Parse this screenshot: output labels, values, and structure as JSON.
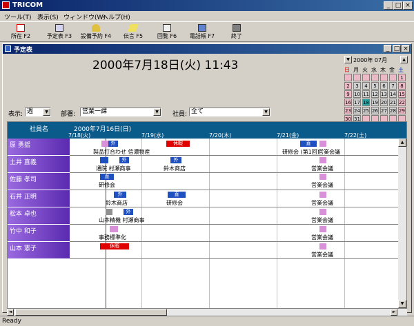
{
  "app": {
    "title": "TRICOM",
    "status": "Ready"
  },
  "menu": [
    "ツール(T)",
    "表示(S)",
    "ウィンドウ(W)",
    "ヘルプ(H)"
  ],
  "toolbar": [
    "所在 F2",
    "予定表 F3",
    "設備予約 F4",
    "伝言 F5",
    "回覧 F6",
    "電話帳 F7",
    "終了"
  ],
  "window": {
    "title": "予定表"
  },
  "datetime": "2000年7月18日(火)  11:43",
  "calendar": {
    "title": "2000年 07月",
    "weekdays": [
      "日",
      "月",
      "火",
      "水",
      "木",
      "金",
      "土"
    ],
    "rows": [
      [
        "",
        "",
        "",
        "",
        "",
        "",
        "1"
      ],
      [
        "2",
        "3",
        "4",
        "5",
        "6",
        "7",
        "8"
      ],
      [
        "9",
        "10",
        "11",
        "12",
        "13",
        "14",
        "15"
      ],
      [
        "16",
        "17",
        "18",
        "19",
        "20",
        "21",
        "22"
      ],
      [
        "23",
        "24",
        "25",
        "26",
        "27",
        "28",
        "29"
      ],
      [
        "30",
        "31",
        "",
        "",
        "",
        "",
        ""
      ]
    ]
  },
  "filters": {
    "display_label": "表示:",
    "display_value": "週",
    "dept_label": "部署:",
    "dept_value": "営業一課",
    "staff_label": "社員:",
    "staff_value": "全て"
  },
  "grid": {
    "name_header": "社員名",
    "range_header": "2000年7月16日(日)",
    "days": [
      "7/18(火)",
      "7/19(水)",
      "7/20(木)",
      "7/21(金)",
      "7/22(土)"
    ],
    "names": [
      "原 勇揺",
      "土井 直義",
      "佐藤 孝司",
      "石井 正明",
      "松本 卓也",
      "竹中 和子",
      "山本 憲子"
    ],
    "chips": {
      "gai": "外",
      "choku": "直",
      "kyuka": "休暇"
    },
    "events": {
      "r0c0": "製品打合わせ 信濃物産",
      "r0c3": "研修会 (第1回)",
      "r0c3b": "営業会議",
      "r1c0": "通院 村瀬商事",
      "r1c1": "鈴木商店",
      "r1c4": "営業会議",
      "r2c0": "研修会",
      "r2c4": "営業会議",
      "r3c0": "鈴木商店",
      "r3c1": "研修会",
      "r3c4": "営業会議",
      "r4c0": "山本精機 村瀬商事",
      "r4c4": "営業会議",
      "r5c0": "事務標準化",
      "r5c4": "営業会議",
      "r6c4": "営業会議"
    }
  }
}
